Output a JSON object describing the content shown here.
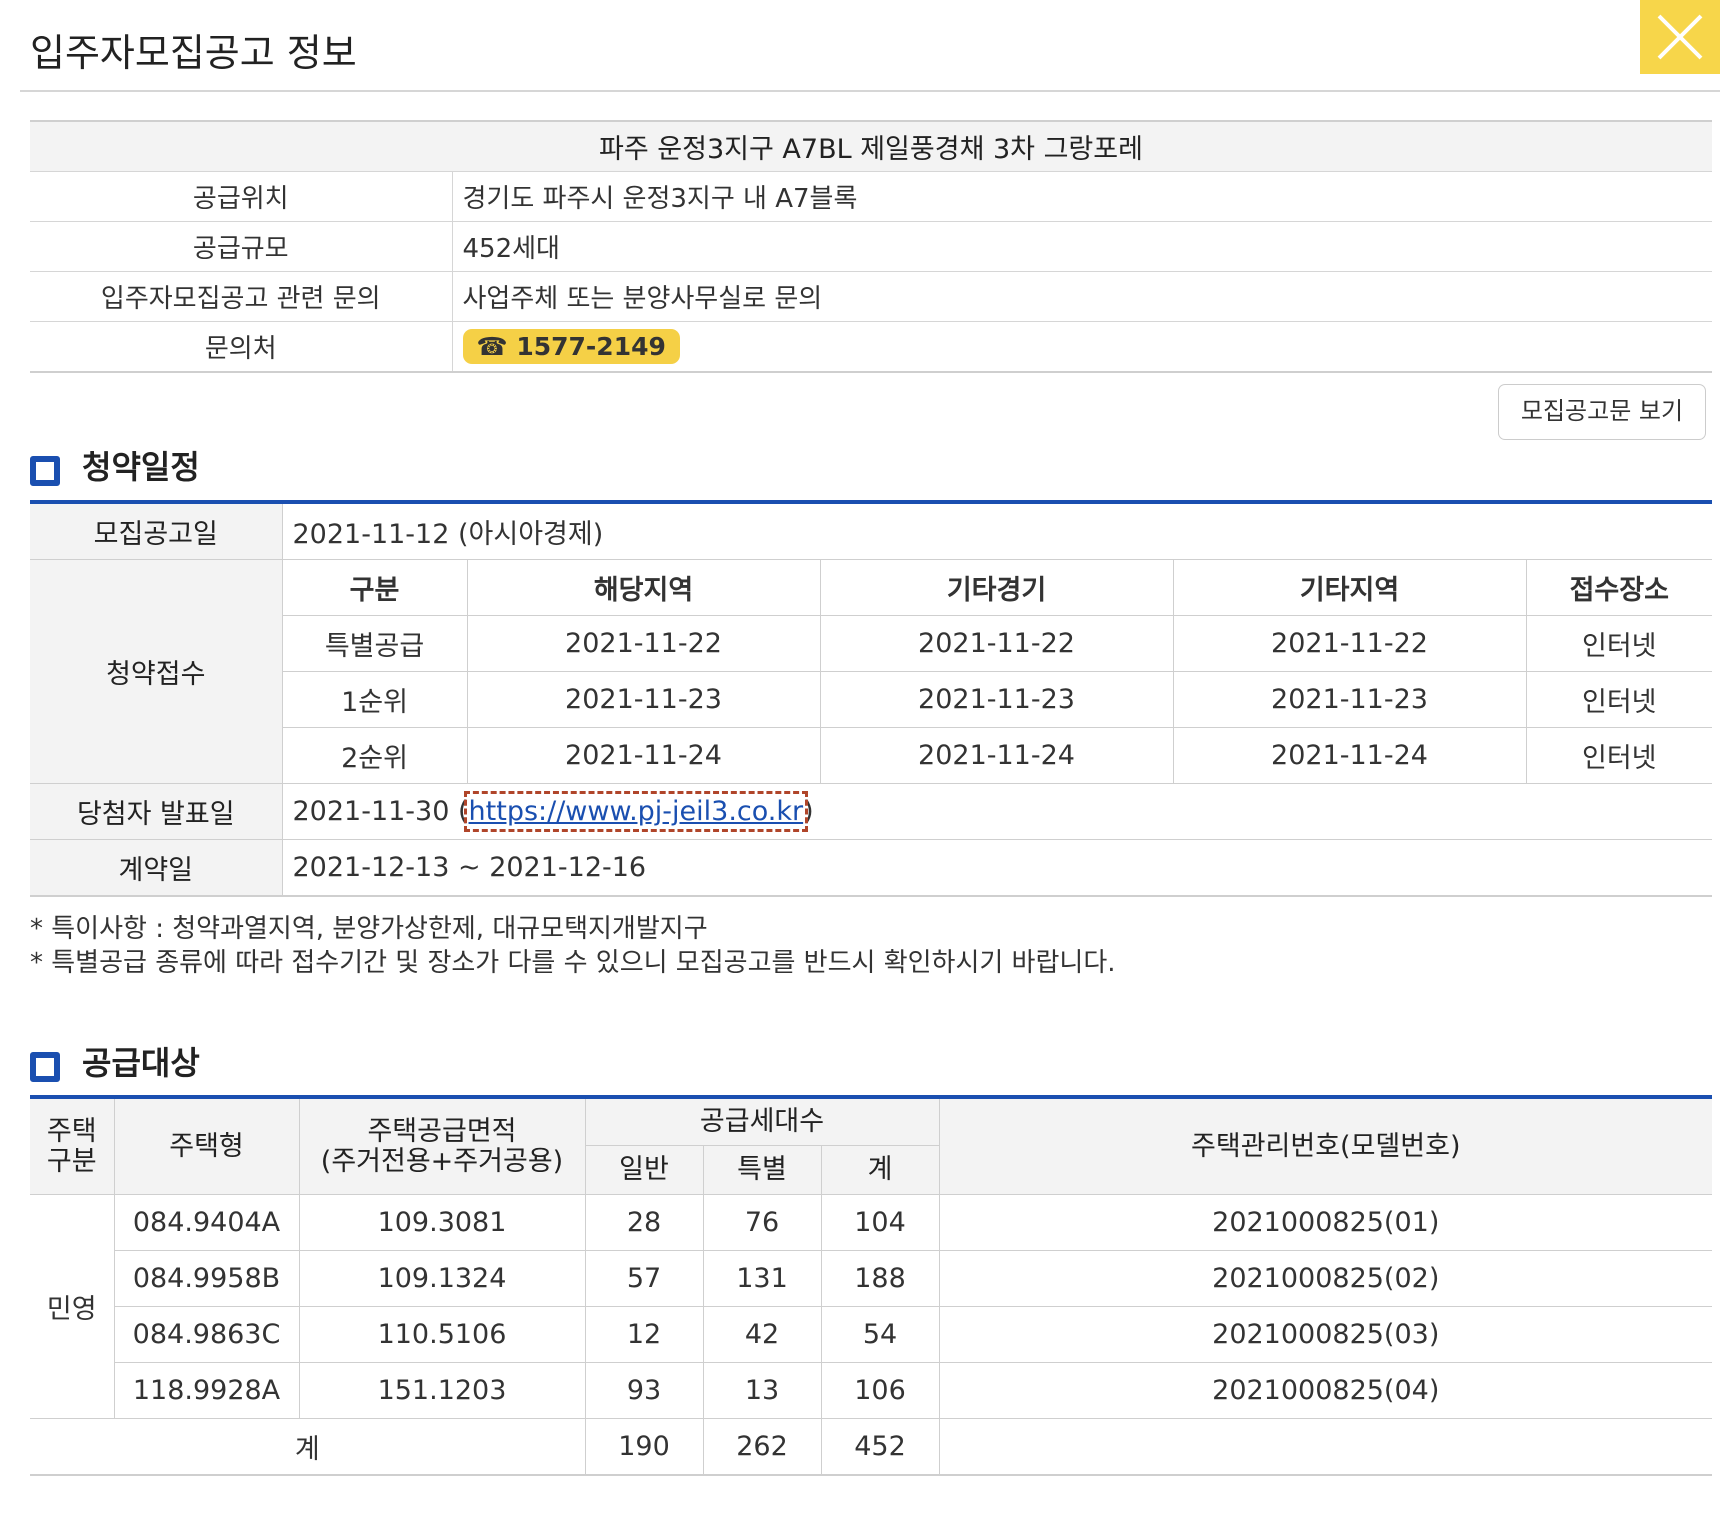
{
  "header": {
    "title": "입주자모집공고 정보",
    "close_icon": "close-icon"
  },
  "info": {
    "project_name": "파주 운정3지구 A7BL 제일풍경채 3차 그랑포레",
    "rows": [
      {
        "label": "공급위치",
        "value": "경기도 파주시 운정3지구 내 A7블록"
      },
      {
        "label": "공급규모",
        "value": "452세대"
      },
      {
        "label": "입주자모집공고 관련 문의",
        "value": "사업주체 또는 분양사무실로 문의"
      }
    ],
    "contact_label": "문의처",
    "contact_phone": "☎ 1577-2149"
  },
  "notice_button": "모집공고문 보기",
  "schedule": {
    "title": "청약일정",
    "announcement_label": "모집공고일",
    "announcement_value": "2021-11-12 (아시아경제)",
    "application_label": "청약접수",
    "columns": [
      "구분",
      "해당지역",
      "기타경기",
      "기타지역",
      "접수장소"
    ],
    "rows": [
      [
        "특별공급",
        "2021-11-22",
        "2021-11-22",
        "2021-11-22",
        "인터넷"
      ],
      [
        "1순위",
        "2021-11-23",
        "2021-11-23",
        "2021-11-23",
        "인터넷"
      ],
      [
        "2순위",
        "2021-11-24",
        "2021-11-24",
        "2021-11-24",
        "인터넷"
      ]
    ],
    "winner_label": "당첨자 발표일",
    "winner_date": "2021-11-30 (",
    "winner_link": "https://www.pj-jeil3.co.kr",
    "winner_close": ")",
    "contract_label": "계약일",
    "contract_value": "2021-12-13 ~ 2021-12-16"
  },
  "notes": [
    "* 특이사항 : 청약과열지역, 분양가상한제, 대규모택지개발지구",
    "* 특별공급 종류에 따라 접수기간 및 장소가 다를 수 있으니 모집공고를 반드시 확인하시기 바랍니다."
  ],
  "supply": {
    "title": "공급대상",
    "headers": {
      "house_type_div": "주택\n구분",
      "house_type": "주택형",
      "area": "주택공급면적\n(주거전용+주거공용)",
      "households": "공급세대수",
      "general": "일반",
      "special": "특별",
      "total": "계",
      "model": "주택관리번호(모델번호)"
    },
    "category": "민영",
    "rows": [
      {
        "type": "084.9404A",
        "area": "109.3081",
        "general": "28",
        "special": "76",
        "total": "104",
        "model": "2021000825(01)"
      },
      {
        "type": "084.9958B",
        "area": "109.1324",
        "general": "57",
        "special": "131",
        "total": "188",
        "model": "2021000825(02)"
      },
      {
        "type": "084.9863C",
        "area": "110.5106",
        "general": "12",
        "special": "42",
        "total": "54",
        "model": "2021000825(03)"
      },
      {
        "type": "118.9928A",
        "area": "151.1203",
        "general": "93",
        "special": "13",
        "total": "106",
        "model": "2021000825(04)"
      }
    ],
    "sum_label": "계",
    "sum_general": "190",
    "sum_special": "262",
    "sum_total": "452"
  },
  "colors": {
    "accent": "#1a4fb0",
    "highlight": "#f7d64a",
    "row_header_bg": "#f3f3f3"
  }
}
